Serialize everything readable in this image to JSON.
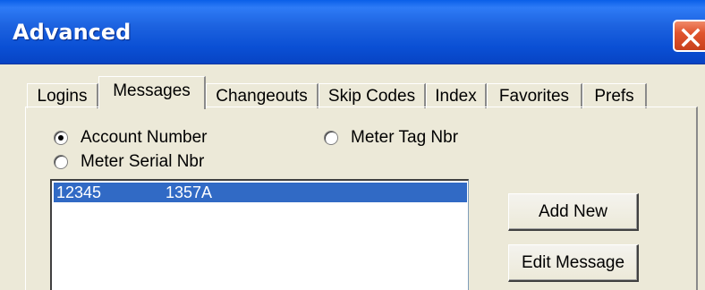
{
  "window": {
    "title": "Advanced",
    "close_icon": "close-x-icon",
    "accent_color": "#0A4FD4",
    "close_color": "#E0542E"
  },
  "tabs": [
    {
      "label": "Logins",
      "active": false
    },
    {
      "label": "Messages",
      "active": true
    },
    {
      "label": "Changeouts",
      "active": false
    },
    {
      "label": "Skip Codes",
      "active": false
    },
    {
      "label": "Index",
      "active": false
    },
    {
      "label": "Favorites",
      "active": false
    },
    {
      "label": "Prefs",
      "active": false
    }
  ],
  "search_by": {
    "options": [
      {
        "label": "Account Number",
        "checked": true
      },
      {
        "label": "Meter Tag Nbr",
        "checked": false
      },
      {
        "label": "Meter Serial Nbr",
        "checked": false
      }
    ]
  },
  "list": {
    "rows": [
      {
        "col1": "12345",
        "col2": "1357A",
        "selected": true
      }
    ],
    "selection_color": "#316AC5"
  },
  "buttons": {
    "add_new": "Add New",
    "edit_message": "Edit Message"
  }
}
